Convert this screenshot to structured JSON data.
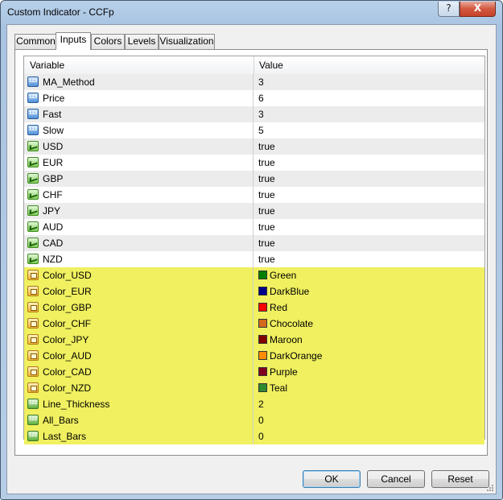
{
  "window": {
    "title": "Custom Indicator - CCFp",
    "help_label": "?",
    "close_label": "X"
  },
  "tabs": [
    {
      "label": "Common"
    },
    {
      "label": "Inputs"
    },
    {
      "label": "Colors"
    },
    {
      "label": "Levels"
    },
    {
      "label": "Visualization"
    }
  ],
  "active_tab": "Inputs",
  "grid": {
    "columns": {
      "variable": "Variable",
      "value": "Value"
    },
    "rows": [
      {
        "name": "MA_Method",
        "value": "3",
        "type": "int"
      },
      {
        "name": "Price",
        "value": "6",
        "type": "int"
      },
      {
        "name": "Fast",
        "value": "3",
        "type": "int"
      },
      {
        "name": "Slow",
        "value": "5",
        "type": "int"
      },
      {
        "name": "USD",
        "value": "true",
        "type": "bool"
      },
      {
        "name": "EUR",
        "value": "true",
        "type": "bool"
      },
      {
        "name": "GBP",
        "value": "true",
        "type": "bool"
      },
      {
        "name": "CHF",
        "value": "true",
        "type": "bool"
      },
      {
        "name": "JPY",
        "value": "true",
        "type": "bool"
      },
      {
        "name": "AUD",
        "value": "true",
        "type": "bool"
      },
      {
        "name": "CAD",
        "value": "true",
        "type": "bool"
      },
      {
        "name": "NZD",
        "value": "true",
        "type": "bool"
      },
      {
        "name": "Color_USD",
        "value": "Green",
        "type": "color",
        "swatch": "#008000"
      },
      {
        "name": "Color_EUR",
        "value": "DarkBlue",
        "type": "color",
        "swatch": "#00008b"
      },
      {
        "name": "Color_GBP",
        "value": "Red",
        "type": "color",
        "swatch": "#ff0000"
      },
      {
        "name": "Color_CHF",
        "value": "Chocolate",
        "type": "color",
        "swatch": "#d2691e"
      },
      {
        "name": "Color_JPY",
        "value": "Maroon",
        "type": "color",
        "swatch": "#800000"
      },
      {
        "name": "Color_AUD",
        "value": "DarkOrange",
        "type": "color",
        "swatch": "#ff8c00"
      },
      {
        "name": "Color_CAD",
        "value": "Purple",
        "type": "color",
        "swatch": "#800020"
      },
      {
        "name": "Color_NZD",
        "value": "Teal",
        "type": "color",
        "swatch": "#2e8b2e"
      },
      {
        "name": "Line_Thickness",
        "value": "2",
        "type": "int_highlight"
      },
      {
        "name": "All_Bars",
        "value": "0",
        "type": "int_highlight"
      },
      {
        "name": "Last_Bars",
        "value": "0",
        "type": "int_highlight"
      }
    ]
  },
  "buttons": {
    "ok": "OK",
    "cancel": "Cancel",
    "reset": "Reset"
  },
  "colors": {
    "row_gray": "#ececec",
    "row_white": "#ffffff",
    "row_highlight": "#f0f060"
  }
}
